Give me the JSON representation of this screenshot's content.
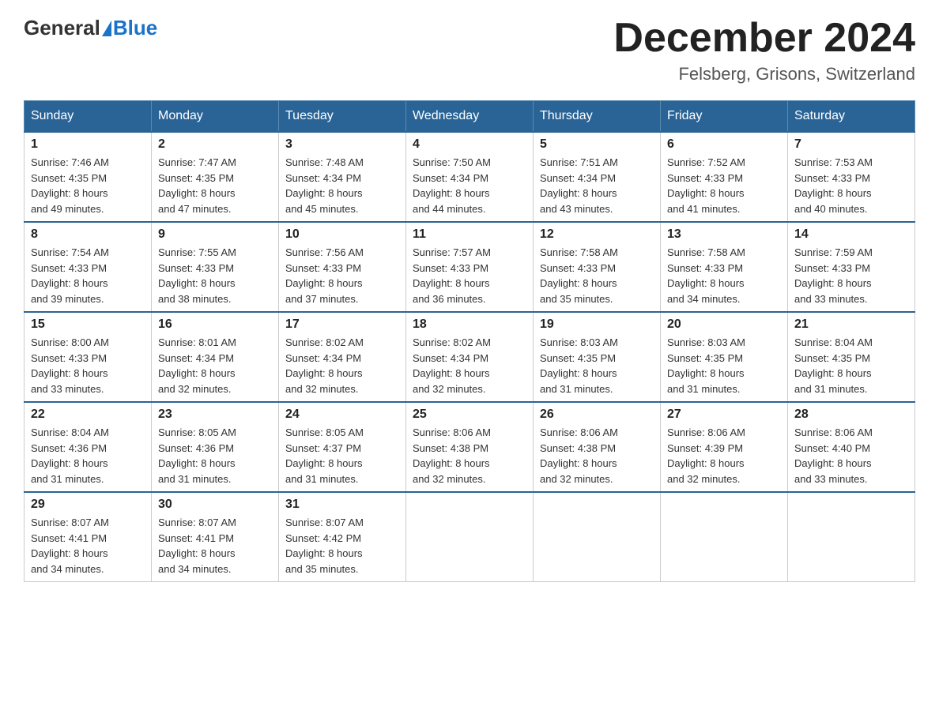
{
  "header": {
    "logo_general": "General",
    "logo_blue": "Blue",
    "month_title": "December 2024",
    "location": "Felsberg, Grisons, Switzerland"
  },
  "days_of_week": [
    "Sunday",
    "Monday",
    "Tuesday",
    "Wednesday",
    "Thursday",
    "Friday",
    "Saturday"
  ],
  "weeks": [
    [
      {
        "day": "1",
        "sunrise": "7:46 AM",
        "sunset": "4:35 PM",
        "daylight": "8 hours and 49 minutes."
      },
      {
        "day": "2",
        "sunrise": "7:47 AM",
        "sunset": "4:35 PM",
        "daylight": "8 hours and 47 minutes."
      },
      {
        "day": "3",
        "sunrise": "7:48 AM",
        "sunset": "4:34 PM",
        "daylight": "8 hours and 45 minutes."
      },
      {
        "day": "4",
        "sunrise": "7:50 AM",
        "sunset": "4:34 PM",
        "daylight": "8 hours and 44 minutes."
      },
      {
        "day": "5",
        "sunrise": "7:51 AM",
        "sunset": "4:34 PM",
        "daylight": "8 hours and 43 minutes."
      },
      {
        "day": "6",
        "sunrise": "7:52 AM",
        "sunset": "4:33 PM",
        "daylight": "8 hours and 41 minutes."
      },
      {
        "day": "7",
        "sunrise": "7:53 AM",
        "sunset": "4:33 PM",
        "daylight": "8 hours and 40 minutes."
      }
    ],
    [
      {
        "day": "8",
        "sunrise": "7:54 AM",
        "sunset": "4:33 PM",
        "daylight": "8 hours and 39 minutes."
      },
      {
        "day": "9",
        "sunrise": "7:55 AM",
        "sunset": "4:33 PM",
        "daylight": "8 hours and 38 minutes."
      },
      {
        "day": "10",
        "sunrise": "7:56 AM",
        "sunset": "4:33 PM",
        "daylight": "8 hours and 37 minutes."
      },
      {
        "day": "11",
        "sunrise": "7:57 AM",
        "sunset": "4:33 PM",
        "daylight": "8 hours and 36 minutes."
      },
      {
        "day": "12",
        "sunrise": "7:58 AM",
        "sunset": "4:33 PM",
        "daylight": "8 hours and 35 minutes."
      },
      {
        "day": "13",
        "sunrise": "7:58 AM",
        "sunset": "4:33 PM",
        "daylight": "8 hours and 34 minutes."
      },
      {
        "day": "14",
        "sunrise": "7:59 AM",
        "sunset": "4:33 PM",
        "daylight": "8 hours and 33 minutes."
      }
    ],
    [
      {
        "day": "15",
        "sunrise": "8:00 AM",
        "sunset": "4:33 PM",
        "daylight": "8 hours and 33 minutes."
      },
      {
        "day": "16",
        "sunrise": "8:01 AM",
        "sunset": "4:34 PM",
        "daylight": "8 hours and 32 minutes."
      },
      {
        "day": "17",
        "sunrise": "8:02 AM",
        "sunset": "4:34 PM",
        "daylight": "8 hours and 32 minutes."
      },
      {
        "day": "18",
        "sunrise": "8:02 AM",
        "sunset": "4:34 PM",
        "daylight": "8 hours and 32 minutes."
      },
      {
        "day": "19",
        "sunrise": "8:03 AM",
        "sunset": "4:35 PM",
        "daylight": "8 hours and 31 minutes."
      },
      {
        "day": "20",
        "sunrise": "8:03 AM",
        "sunset": "4:35 PM",
        "daylight": "8 hours and 31 minutes."
      },
      {
        "day": "21",
        "sunrise": "8:04 AM",
        "sunset": "4:35 PM",
        "daylight": "8 hours and 31 minutes."
      }
    ],
    [
      {
        "day": "22",
        "sunrise": "8:04 AM",
        "sunset": "4:36 PM",
        "daylight": "8 hours and 31 minutes."
      },
      {
        "day": "23",
        "sunrise": "8:05 AM",
        "sunset": "4:36 PM",
        "daylight": "8 hours and 31 minutes."
      },
      {
        "day": "24",
        "sunrise": "8:05 AM",
        "sunset": "4:37 PM",
        "daylight": "8 hours and 31 minutes."
      },
      {
        "day": "25",
        "sunrise": "8:06 AM",
        "sunset": "4:38 PM",
        "daylight": "8 hours and 32 minutes."
      },
      {
        "day": "26",
        "sunrise": "8:06 AM",
        "sunset": "4:38 PM",
        "daylight": "8 hours and 32 minutes."
      },
      {
        "day": "27",
        "sunrise": "8:06 AM",
        "sunset": "4:39 PM",
        "daylight": "8 hours and 32 minutes."
      },
      {
        "day": "28",
        "sunrise": "8:06 AM",
        "sunset": "4:40 PM",
        "daylight": "8 hours and 33 minutes."
      }
    ],
    [
      {
        "day": "29",
        "sunrise": "8:07 AM",
        "sunset": "4:41 PM",
        "daylight": "8 hours and 34 minutes."
      },
      {
        "day": "30",
        "sunrise": "8:07 AM",
        "sunset": "4:41 PM",
        "daylight": "8 hours and 34 minutes."
      },
      {
        "day": "31",
        "sunrise": "8:07 AM",
        "sunset": "4:42 PM",
        "daylight": "8 hours and 35 minutes."
      },
      null,
      null,
      null,
      null
    ]
  ],
  "labels": {
    "sunrise": "Sunrise:",
    "sunset": "Sunset:",
    "daylight": "Daylight:"
  }
}
